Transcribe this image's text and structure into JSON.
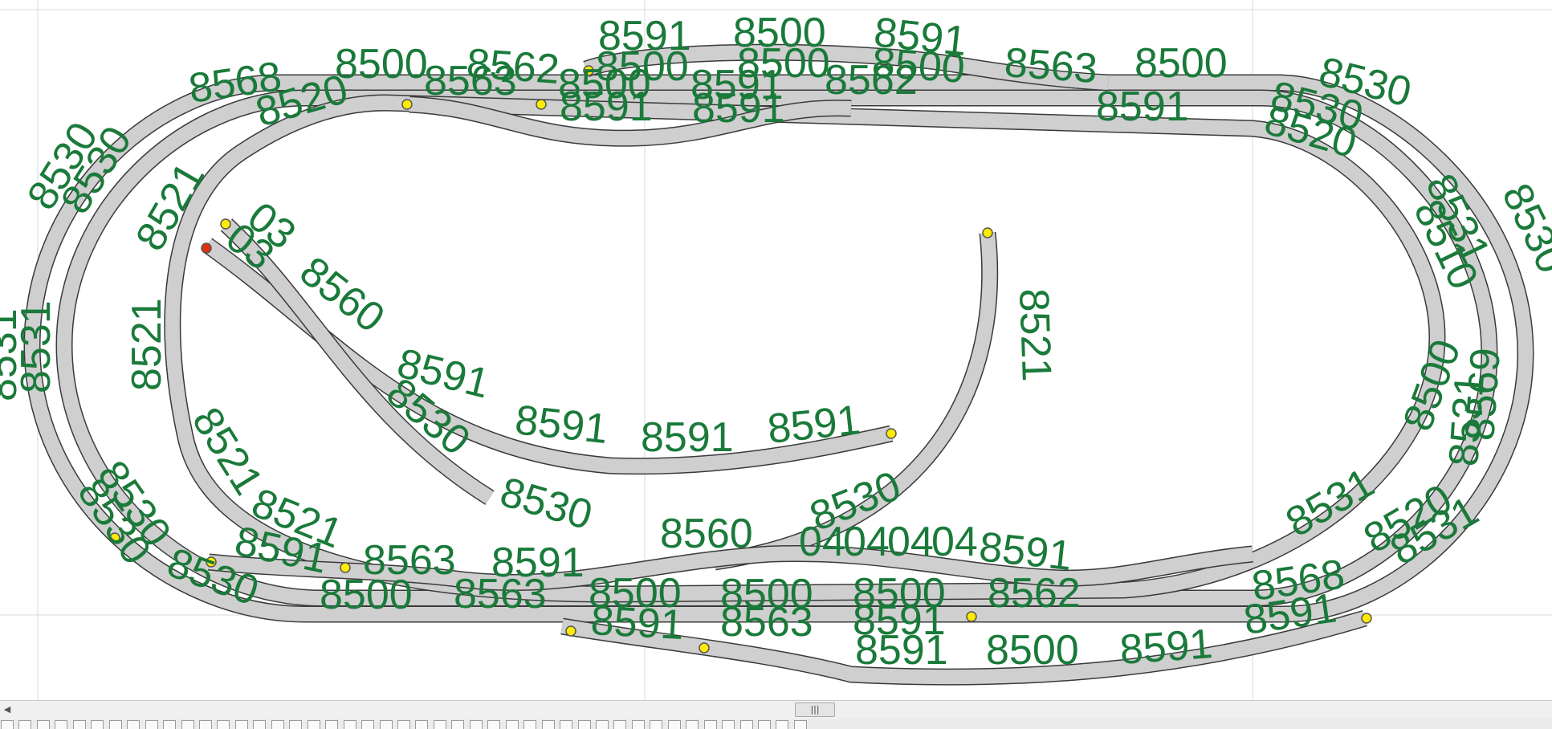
{
  "app": {
    "colors": {
      "label_green": "#1a7a3a",
      "track_fill": "#cfcfcf",
      "track_edge": "#3a3a3a",
      "sensor_yellow": "#ffeb00",
      "sensor_red": "#e03010",
      "grid": "#d8d8d8"
    }
  },
  "canvas": {
    "track_labels": [
      "8591",
      "8500",
      "8591",
      "8568",
      "8500",
      "8562",
      "8500",
      "8500",
      "8500",
      "8563",
      "8500",
      "8530",
      "8520",
      "8563",
      "8500",
      "8591",
      "8562",
      "8530",
      "8591",
      "8591",
      "8591",
      "8520",
      "8530",
      "8530",
      "8521",
      "8531",
      "8530",
      "8510",
      "8531",
      "03",
      "03",
      "8560",
      "8521",
      "8531",
      "8521",
      "8591",
      "8530",
      "8500",
      "8569",
      "8531",
      "8591",
      "8591",
      "8591",
      "8521",
      "8530",
      "8521",
      "8530",
      "8560",
      "04",
      "04",
      "04",
      "04",
      "8591",
      "8531",
      "8520",
      "8531",
      "8530",
      "8530",
      "8591",
      "8563",
      "8591",
      "8530",
      "8500",
      "8563",
      "8500",
      "8500",
      "8500",
      "8562",
      "8568",
      "8591",
      "8563",
      "8591",
      "8591",
      "8591",
      "8500",
      "8591"
    ]
  },
  "scrollbar": {
    "left_arrow": "◀",
    "thumb_grip": "|||"
  }
}
